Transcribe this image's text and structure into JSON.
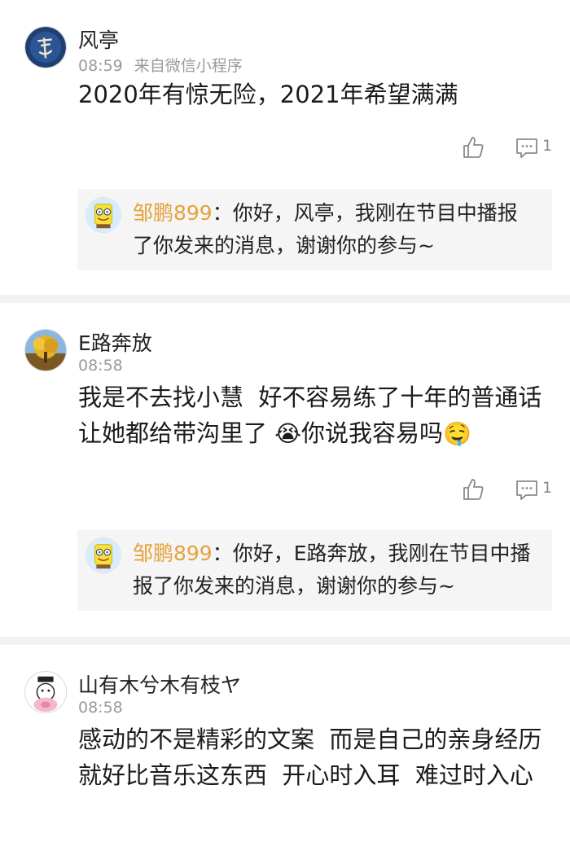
{
  "comments": [
    {
      "user": "风亭",
      "time": "08:59",
      "source": "来自微信小程序",
      "text": "2020年有惊无险，2021年希望满满",
      "comment_count": "1",
      "reply": {
        "name": "邹鹏899",
        "separator": "：",
        "text": "你好，风亭，我刚在节目中播报了你发来的消息，谢谢你的参与~"
      }
    },
    {
      "user": "E路奔放",
      "time": "08:58",
      "text_part1": "我是不去找小慧  好不容易练了十年的普通话  让她都给带沟里了 ",
      "emoji1": "😭",
      "text_part2": "你说我容易吗",
      "emoji2": "🤤",
      "comment_count": "1",
      "reply": {
        "name": "邹鹏899",
        "separator": "：",
        "text": "你好，E路奔放，我刚在节目中播报了你发来的消息，谢谢你的参与~"
      }
    },
    {
      "user": "山有木兮木有枝ヤ",
      "time": "08:58",
      "text": "感动的不是精彩的文案  而是自己的亲身经历  就好比音乐这东西  开心时入耳  难过时入心"
    }
  ],
  "icons": {
    "like": "thumbs-up-icon",
    "comment": "comment-icon"
  },
  "colors": {
    "reply_name": "#e6a23c",
    "meta_text": "#9a9a9a",
    "reply_background": "#f5f5f5"
  }
}
